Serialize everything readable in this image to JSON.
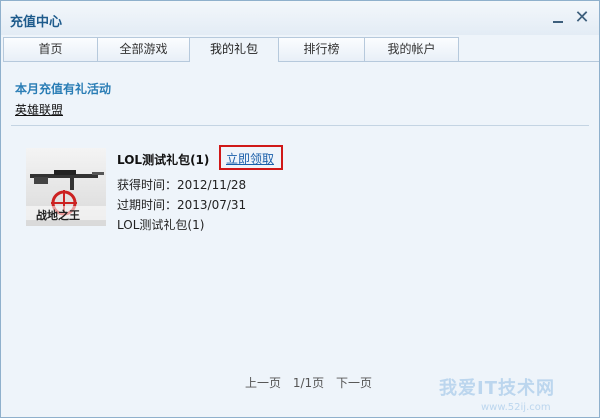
{
  "window": {
    "title": "充值中心"
  },
  "tabs": [
    {
      "label": "首页"
    },
    {
      "label": "全部游戏"
    },
    {
      "label": "我的礼包"
    },
    {
      "label": "排行榜"
    },
    {
      "label": "我的帐户"
    }
  ],
  "active_tab": "我的礼包",
  "promo": {
    "title": "本月充值有礼活动",
    "game_link": "英雄联盟"
  },
  "gift": {
    "name": "LOL测试礼包(1)",
    "claim_label": "立即领取",
    "obtained": "获得时间：2012/11/28",
    "expires": "过期时间：2013/07/31",
    "description": "LOL测试礼包(1)",
    "thumb_text": "战地之王"
  },
  "pager": {
    "prev": "上一页",
    "status": "1/1页",
    "next": "下一页"
  },
  "watermark": {
    "main": "我爱IT技术网",
    "url": "www.52ij.com"
  },
  "colors": {
    "accent": "#2a7db5",
    "highlight_border": "#d01818",
    "link": "#1a5faa"
  }
}
